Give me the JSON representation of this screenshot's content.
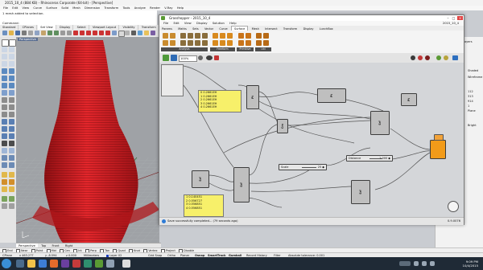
{
  "rhino": {
    "title": "2015_10_4 (884 KB) - Rhinoceros Corporate (64-bit) - [Perspective]",
    "menu": [
      "File",
      "Edit",
      "View",
      "Curve",
      "Surface",
      "Solid",
      "Mesh",
      "Dimension",
      "Transform",
      "Tools",
      "Analyze",
      "Render",
      "V-Ray",
      "Help"
    ],
    "command_history": [
      "1 mesh added to selection.",
      "",
      "Command:"
    ],
    "tabs": [
      "Standard",
      "CPlanes",
      "Set View",
      "Display",
      "Select",
      "Viewport Layout",
      "Visibility",
      "Transform",
      "Curve Tools",
      "Surface"
    ],
    "active_tab": "Set View",
    "viewport_label": "Perspective",
    "viewport_tabs": [
      "Perspective",
      "Top",
      "Front",
      "Right"
    ],
    "osnaps": [
      "End",
      "Near",
      "Point",
      "Mid",
      "Cen",
      "Int",
      "Perp",
      "Tan",
      "Quad",
      "Knot",
      "Vertex",
      "Project",
      "Disable"
    ],
    "status": {
      "cplane": "CPlane",
      "x": "x 463.277",
      "y": "y -8.594",
      "z": "z 0.000",
      "units": "Millimeters",
      "layer": "Layer 02",
      "grid_snap": "Grid Snap",
      "ortho": "Ortho",
      "planar": "Planar",
      "osnap": "Osnap",
      "smarttrack": "SmartTrack",
      "gumball": "Gumball",
      "record_history": "Record History",
      "filter": "Filter",
      "tolerance": "Absolute tolerance: 0.001"
    },
    "right_panel_values": [
      "Properties",
      "Layers",
      "Shaded",
      "Wireframe",
      "112",
      "313",
      "914",
      "1",
      "Plane",
      "Bright"
    ],
    "colors": {
      "mesh": "#d8191e",
      "viewport_bg": "#9fa2a6"
    }
  },
  "grasshopper": {
    "title": "Grasshopper - 2015_10_4",
    "menu": [
      "File",
      "Edit",
      "View",
      "Display",
      "Solution",
      "Help"
    ],
    "doc_name": "2015_10_4",
    "tabs": [
      "Params",
      "Maths",
      "Sets",
      "Vector",
      "Curve",
      "Surface",
      "Mesh",
      "Intersect",
      "Transform",
      "Display",
      "LunchBox"
    ],
    "active_tab": "Surface",
    "ribbon_groups": [
      "Analysis",
      "Freeform",
      "Primitive",
      "Util"
    ],
    "zoom": "100%",
    "status_message": "Save successfully completed... (79 seconds ago)",
    "version": "0.9.0076",
    "panels": [
      {
        "lines": [
          "0 0.2661EH",
          "1 0.2661EH",
          "2 0.2661EH",
          "3 0.2661EH",
          "4 0.2661EH"
        ]
      },
      {
        "lines": [
          "1 0.140451",
          "2 0.556727",
          "3 0.556851",
          "4 0.556851"
        ]
      }
    ],
    "sliders": [
      {
        "label": "Scale",
        "value": "25 ◆"
      },
      {
        "label": "Distance",
        "value": "1.000 ◆"
      }
    ],
    "components": [
      "Pt",
      "Crv",
      "Pt",
      "Srf",
      "Srf",
      "Srf",
      "Pt",
      "Srf"
    ],
    "accent_colors": {
      "panel": "#f7f06a",
      "preview": "#f29b19",
      "wire": "#555555"
    }
  },
  "taskbar": {
    "time": "9:09 PM",
    "date": "10/4/2015"
  }
}
